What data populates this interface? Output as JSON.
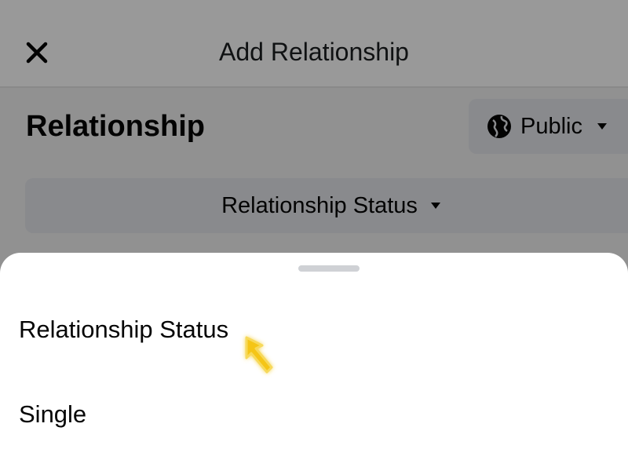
{
  "header": {
    "title": "Add Relationship",
    "close_icon": "close-icon"
  },
  "section": {
    "title": "Relationship"
  },
  "privacy": {
    "label": "Public",
    "icon": "globe-icon"
  },
  "status_selector": {
    "label": "Relationship Status"
  },
  "sheet": {
    "options": [
      {
        "label": "Relationship Status"
      },
      {
        "label": "Single"
      }
    ]
  },
  "colors": {
    "button_bg": "#e4e6eb",
    "text": "#050505",
    "cursor_highlight": "#f5c518"
  }
}
